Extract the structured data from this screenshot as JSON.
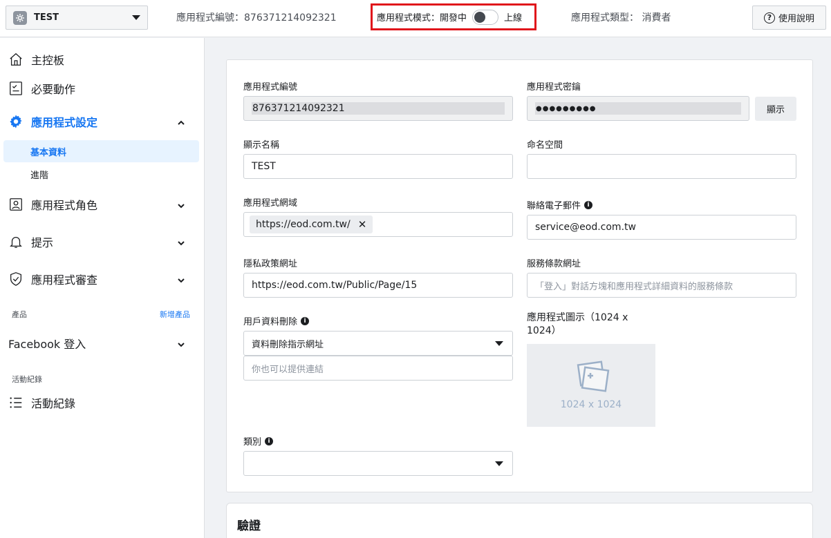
{
  "topbar": {
    "app_name": "TEST",
    "app_id_text": "應用程式編號：876371214092321",
    "mode_label": "應用程式模式：開發中",
    "mode_live": "上線",
    "app_type_text": "應用程式類型： 消費者",
    "help": "使用說明"
  },
  "sidebar": {
    "dashboard": "主控板",
    "required_actions": "必要動作",
    "app_settings": "應用程式設定",
    "basic": "基本資料",
    "advanced": "進階",
    "app_roles": "應用程式角色",
    "alerts": "提示",
    "app_review": "應用程式審查",
    "products_label": "產品",
    "add_product": "新增產品",
    "facebook_login": "Facebook 登入",
    "activity_label": "活動紀錄",
    "activity_log": "活動紀錄"
  },
  "form": {
    "app_id_label": "應用程式編號",
    "app_id_value": "876371214092321",
    "app_secret_label": "應用程式密鑰",
    "app_secret_value": "●●●●●●●●●",
    "show_button": "顯示",
    "display_name_label": "顯示名稱",
    "display_name_value": "TEST",
    "namespace_label": "命名空間",
    "namespace_value": "",
    "app_domains_label": "應用程式網域",
    "app_domain_chip": "https://eod.com.tw/",
    "contact_email_label": "聯絡電子郵件",
    "contact_email_value": "service@eod.com.tw",
    "privacy_label": "隱私政策網址",
    "privacy_value": "https://eod.com.tw/Public/Page/15",
    "tos_label": "服務條款網址",
    "tos_placeholder": "「登入」對話方塊和應用程式詳細資料的服務條款",
    "data_deletion_label": "用戶資料刪除",
    "data_deletion_select": "資料刪除指示網址",
    "data_deletion_placeholder": "你也可以提供連結",
    "app_icon_label_line1": "應用程式圖示（1024 x",
    "app_icon_label_line2": "1024）",
    "app_icon_dim": "1024 x 1024",
    "category_label": "類別",
    "category_value": ""
  },
  "verification": {
    "title": "驗證"
  }
}
